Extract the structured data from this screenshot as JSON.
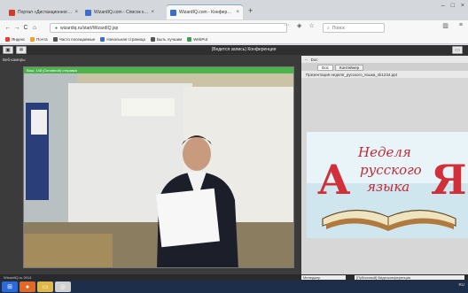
{
  "tabs": [
    {
      "label": "Портал «Дистанционного о...",
      "color": "#d23a2e",
      "active": false
    },
    {
      "label": "WizardIQ.com - Список конф...",
      "color": "#3a6ec8",
      "active": false
    },
    {
      "label": "WizardIQ.com - Конференция",
      "color": "#3a6ec8",
      "active": true
    }
  ],
  "new_tab": "+",
  "window_controls": [
    "–",
    "□",
    "×"
  ],
  "nav": {
    "back": "←",
    "forward": "→",
    "reload": "C",
    "home": "⌂"
  },
  "url": "wizardiq.ru/start/WizardIQ.jsp",
  "search_placeholder": "Поиск",
  "bookmarks": [
    {
      "label": "Яндекс",
      "color": "#e63b2e"
    },
    {
      "label": "Почта",
      "color": "#f4a12b"
    },
    {
      "label": "Часто посещаемые",
      "color": "#555"
    },
    {
      "label": "Начальная страница",
      "color": "#3a6ec8"
    },
    {
      "label": "Быть лучшим",
      "color": "#555"
    },
    {
      "label": "WebPut",
      "color": "#3aa04b"
    }
  ],
  "app": {
    "title": "(Ведется запись) Конференция",
    "webcams_label": "Веб-камеры",
    "video_header": "Ваш: 148 (Основной) отправка",
    "right_panel": {
      "header": "Doc",
      "tabs": [
        "Doc",
        "Контейнер"
      ],
      "file_name": "Презентация неделя_русского_языка_sk1234.ppt"
    },
    "slide": {
      "line1": "Неделя",
      "line2": "русского",
      "line3": "языка",
      "left_letter": "А",
      "right_letter": "Я"
    }
  },
  "status": {
    "left": "WizardIQ.ru 2014",
    "select1": "Менеджер",
    "select2": "[Публичный] Видеоконференция"
  },
  "taskbar": {
    "items": [
      {
        "name": "start",
        "color": "#2b6bd9",
        "glyph": "⊞"
      },
      {
        "name": "firefox",
        "color": "#e06a24",
        "glyph": "●"
      },
      {
        "name": "explorer",
        "color": "#e0b84a",
        "glyph": "▭"
      },
      {
        "name": "chrome",
        "color": "#d0d0d0",
        "glyph": "◎"
      }
    ],
    "tray": "RU"
  }
}
